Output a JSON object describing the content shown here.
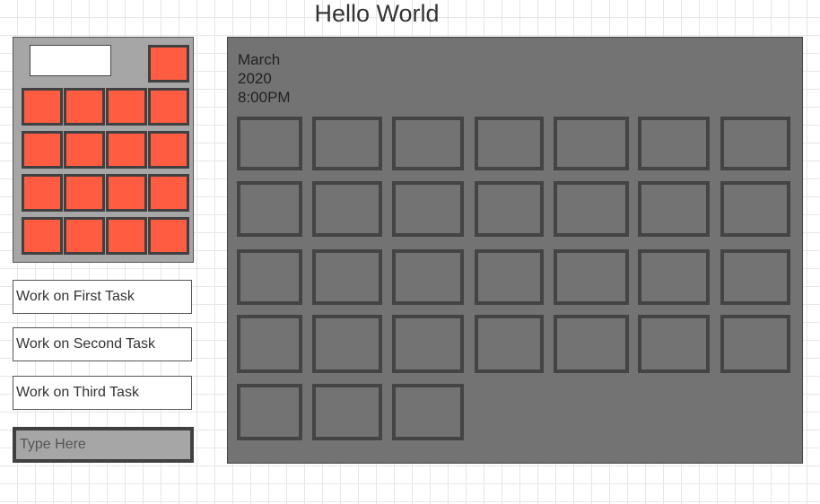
{
  "page": {
    "title": "Hello World"
  },
  "keypad": {
    "display_value": "",
    "key_color": "#ff5c42",
    "panel_color": "#a6a6a6",
    "key_count": 17
  },
  "tasks": [
    {
      "label": "Work on First Task"
    },
    {
      "label": "Work on Second Task"
    },
    {
      "label": "Work on Third Task"
    }
  ],
  "input": {
    "placeholder": "Type Here",
    "value": ""
  },
  "calendar": {
    "month": "March",
    "year": "2020",
    "time": "8:00PM",
    "background_color": "#737373",
    "day_cell_count": 31
  }
}
